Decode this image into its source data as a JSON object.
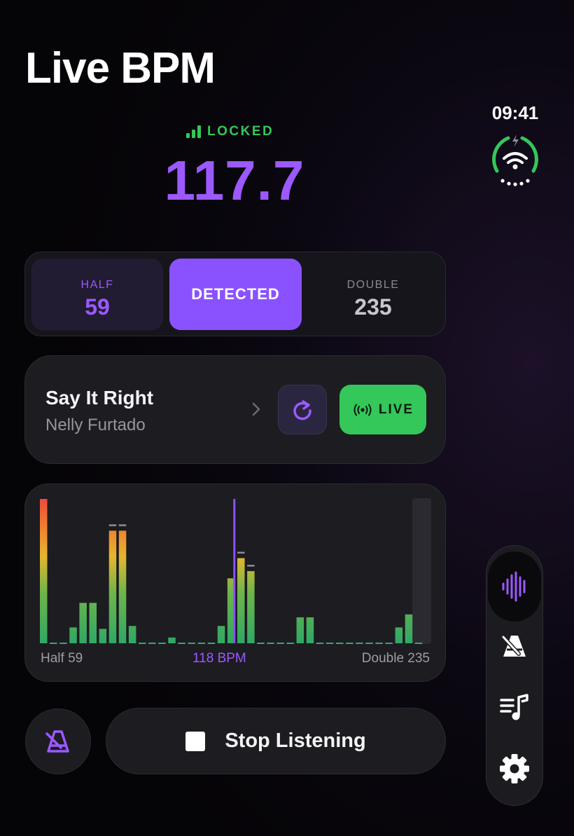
{
  "header": {
    "title": "Live BPM"
  },
  "status": {
    "time": "09:41",
    "icon": "wifi-battery-ring-icon"
  },
  "detection": {
    "state": "LOCKED",
    "bpm": "117.7",
    "state_color": "#34c759",
    "bpm_color": "#9b59ff"
  },
  "tempo_selector": {
    "half": {
      "label": "HALF",
      "value": "59"
    },
    "detected": {
      "label": "DETECTED"
    },
    "double": {
      "label": "DOUBLE",
      "value": "235"
    }
  },
  "track": {
    "title": "Say It Right",
    "artist": "Nelly Furtado",
    "refresh_icon": "refresh-icon",
    "live_label": "LIVE"
  },
  "histogram": {
    "left_label": "Half 59",
    "center_label": "118 BPM",
    "right_label": "Double 235",
    "bins": [
      1.0,
      0.0,
      0.0,
      0.11,
      0.28,
      0.28,
      0.1,
      0.78,
      0.78,
      0.12,
      0.0,
      0.0,
      0.0,
      0.04,
      0.0,
      0.0,
      0.0,
      0.0,
      0.12,
      0.45,
      0.59,
      0.5,
      0.0,
      0.0,
      0.0,
      0.0,
      0.18,
      0.18,
      0.0,
      0.0,
      0.0,
      0.0,
      0.0,
      0.0,
      0.0,
      0.0,
      0.11,
      0.2,
      0.0
    ],
    "peak_marks": [
      7,
      8,
      20,
      21
    ],
    "marker_bin": 19.7,
    "marker_color": "#8a52ff"
  },
  "controls": {
    "metronome_icon": "metronome-icon",
    "stop_label": "Stop Listening"
  },
  "rail": [
    {
      "icon": "waveform-icon",
      "active": true
    },
    {
      "icon": "metronome-icon",
      "active": false
    },
    {
      "icon": "playlist-icon",
      "active": false
    },
    {
      "icon": "gear-icon",
      "active": false
    }
  ]
}
